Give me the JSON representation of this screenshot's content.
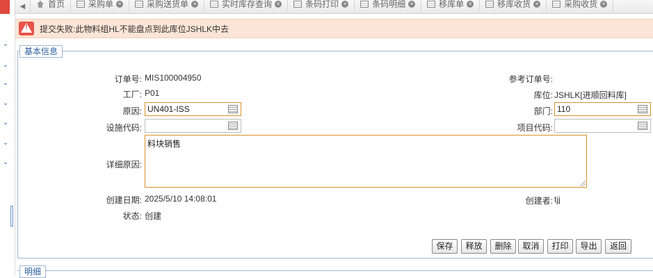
{
  "tabs": [
    {
      "label": "首页",
      "home": true
    },
    {
      "label": "采购单"
    },
    {
      "label": "采购送货单"
    },
    {
      "label": "实时库存查询"
    },
    {
      "label": "条码打印"
    },
    {
      "label": "条码明细"
    },
    {
      "label": "移库单"
    },
    {
      "label": "移库收货"
    },
    {
      "label": "采购收货"
    }
  ],
  "error": {
    "message": "提交失败:此物料组HL不能盘点到此库位JSHLK中去"
  },
  "section1": {
    "legend": "基本信息"
  },
  "section2": {
    "legend": "明细"
  },
  "form": {
    "order_no_label": "订单号:",
    "order_no": "MIS100004950",
    "ref_order_label": "参考订单号:",
    "ref_order": "",
    "factory_label": "工厂:",
    "factory": "P01",
    "location_label": "库位:",
    "location": "JSHLK[进顺回料库]",
    "reason_label": "原因:",
    "reason_value": "UN401-ISS",
    "dept_label": "部门:",
    "dept_value": "110",
    "facility_label": "设施代码:",
    "facility_value": "",
    "project_label": "项目代码:",
    "project_value": "",
    "detail_label": "详细原因:",
    "detail_value": "料块销售",
    "created_date_label": "创建日期:",
    "created_date": "2025/5/10 14:08:01",
    "creator_label": "创建者:",
    "creator": "tjj",
    "status_label": "状态:",
    "status": "创建"
  },
  "buttons": {
    "save": "保存",
    "release": "释放",
    "delete": "删除",
    "cancel": "取消",
    "print": "打印",
    "export": "导出",
    "back": "返回"
  }
}
